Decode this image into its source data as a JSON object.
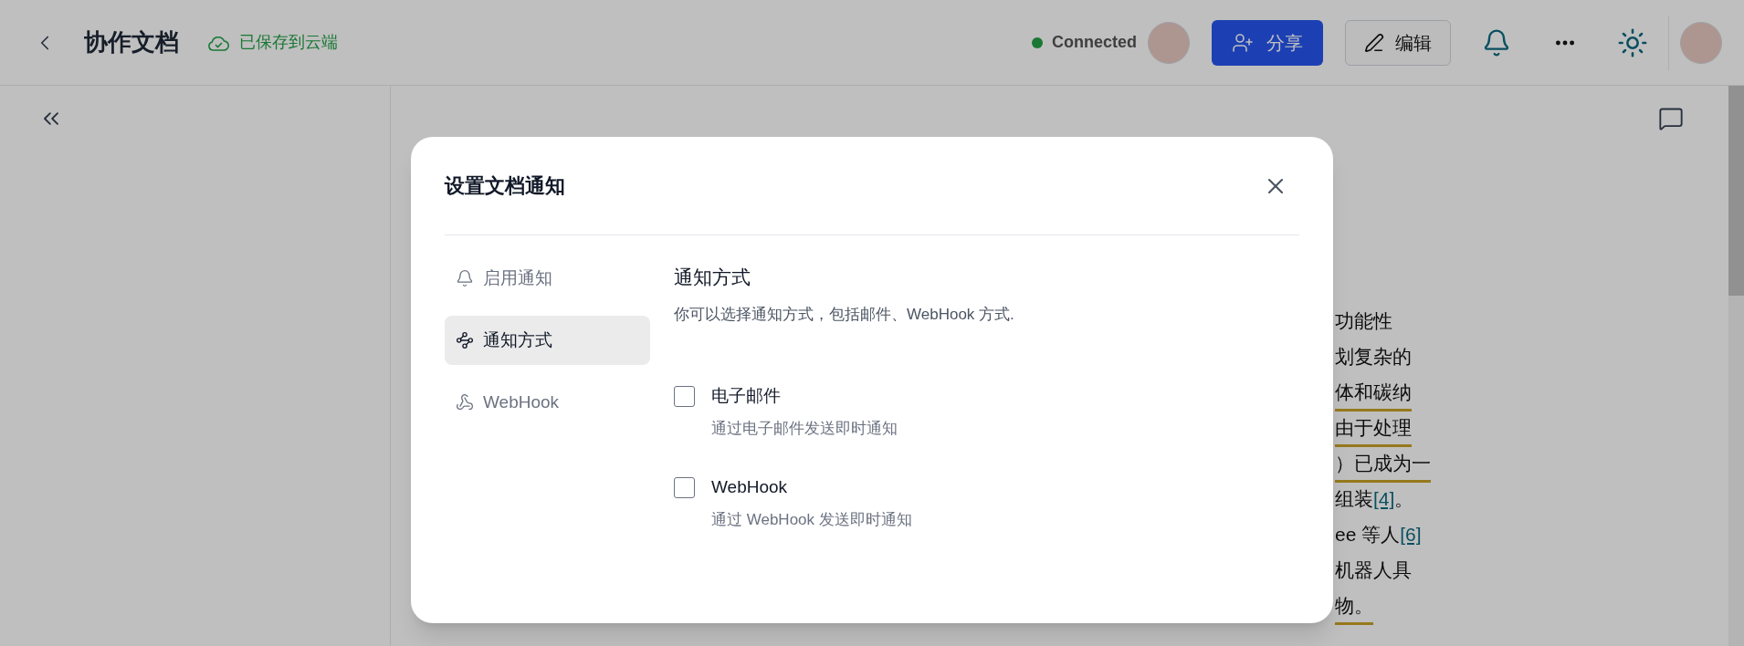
{
  "header": {
    "title": "协作文档",
    "save_status": "已保存到云端",
    "connection": {
      "label": "Connected",
      "connected": true
    },
    "share_button": "分享",
    "edit_button": "编辑"
  },
  "document": {
    "lines": [
      {
        "underlined": false,
        "segments": [
          {
            "kind": "plain",
            "text": "功能性"
          }
        ]
      },
      {
        "underlined": false,
        "segments": [
          {
            "kind": "plain",
            "text": "划复杂的"
          }
        ]
      },
      {
        "underlined": true,
        "segments": [
          {
            "kind": "plain",
            "text": "体和碳纳"
          }
        ]
      },
      {
        "underlined": true,
        "segments": [
          {
            "kind": "plain",
            "text": "由于处理"
          }
        ]
      },
      {
        "underlined": true,
        "segments": [
          {
            "kind": "plain",
            "text": "）已成为一"
          }
        ]
      },
      {
        "underlined": false,
        "segments": [
          {
            "kind": "plain",
            "text": "组装"
          },
          {
            "kind": "link",
            "text": "[4]"
          },
          {
            "kind": "plain",
            "text": "。"
          }
        ]
      },
      {
        "underlined": false,
        "segments": [
          {
            "kind": "plain",
            "text": "ee 等人"
          },
          {
            "kind": "link",
            "text": "[6]"
          }
        ]
      },
      {
        "underlined": false,
        "segments": [
          {
            "kind": "plain",
            "text": "机器人具"
          }
        ]
      },
      {
        "underlined": true,
        "segments": [
          {
            "kind": "plain",
            "text": "物。"
          }
        ]
      }
    ]
  },
  "dialog": {
    "title": "设置文档通知",
    "nav": [
      {
        "label": "启用通知",
        "selected": false
      },
      {
        "label": "通知方式",
        "selected": true
      },
      {
        "label": "WebHook",
        "selected": false
      }
    ],
    "section": {
      "title": "通知方式",
      "description": "你可以选择通知方式，包括邮件、WebHook 方式."
    },
    "options": [
      {
        "label": "电子邮件",
        "description": "通过电子邮件发送即时通知",
        "checked": false
      },
      {
        "label": "WebHook",
        "description": "通过 WebHook 发送即时通知",
        "checked": false
      }
    ]
  }
}
